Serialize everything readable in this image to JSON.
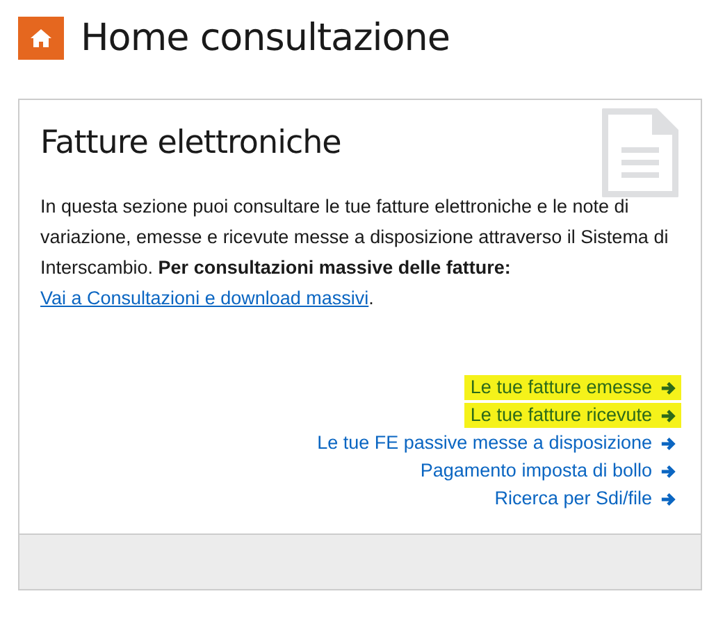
{
  "page": {
    "title": "Home consultazione"
  },
  "card": {
    "title": "Fatture elettroniche",
    "description": "In questa sezione puoi consultare le tue fatture elettroniche e le note di variazione, emesse e ricevute messe a disposizione attraverso il Sistema di Interscambio. **Per consultazioni massive delle fatture:**",
    "inline_link": "Vai a Consultazioni e download massivi",
    "inline_link_suffix": ".",
    "links": [
      {
        "label": "Le tue fatture emesse",
        "highlighted": true
      },
      {
        "label": "Le tue fatture ricevute",
        "highlighted": true
      },
      {
        "label": "Le tue FE passive messe a disposizione",
        "highlighted": false
      },
      {
        "label": "Pagamento imposta di bollo",
        "highlighted": false
      },
      {
        "label": "Ricerca per Sdi/file",
        "highlighted": false
      }
    ]
  }
}
